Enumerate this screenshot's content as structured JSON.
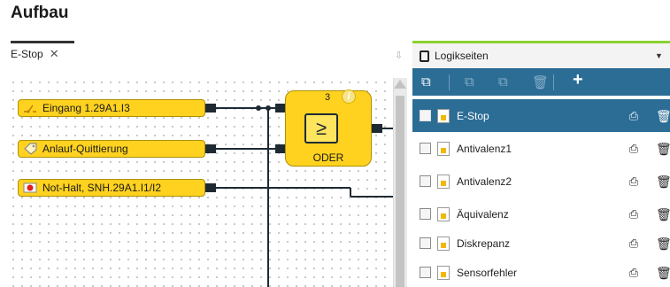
{
  "section_title": "Aufbau",
  "editor_tab": {
    "label": "E-Stop",
    "close": "✕"
  },
  "blocks": [
    {
      "label": "Eingang 1.29A1.I3"
    },
    {
      "label": "Anlauf-Quittierung"
    },
    {
      "label": "Not-Halt, SNH.29A1.I1/I2"
    }
  ],
  "function_block": {
    "number": "3",
    "symbol": "≥",
    "label": "ODER",
    "info": "i"
  },
  "panel": {
    "title": "Logikseiten"
  },
  "toolbar": {
    "add": "+"
  },
  "pages": [
    {
      "name": "E-Stop",
      "selected": true
    },
    {
      "name": "Antivalenz1",
      "selected": false
    },
    {
      "name": "Antivalenz2",
      "selected": false
    },
    {
      "name": "Äquivalenz",
      "selected": false
    },
    {
      "name": "Diskrepanz",
      "selected": false
    },
    {
      "name": "Sensorfehler",
      "selected": false
    }
  ],
  "colors": {
    "block": "#ffd21f",
    "toolbar": "#2c6d96",
    "panel_accent": "#8ad12f"
  }
}
